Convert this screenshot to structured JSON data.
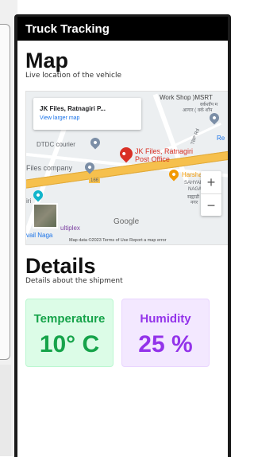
{
  "app": {
    "title": "Truck Tracking"
  },
  "map_section": {
    "title": "Map",
    "subtitle": "Live location of the vehicle",
    "map": {
      "info_title": "JK Files, Ratnagiri P...",
      "info_link": "View larger map",
      "place_workshop": "Work Shop )MSRT",
      "place_workshop_local": "वर्कशॉप म",
      "place_workshop_local2": "आगार ( वर्क शॉप",
      "place_dtdc": "DTDC courier",
      "place_pin_line1": "JK Files, Ratnagiri",
      "place_pin_line2": "Post Office",
      "place_files_company": "Files company",
      "place_haruba": "Harsha Te",
      "place_sahyadri": "SAHYADRI",
      "place_nagar": "NAGAR",
      "place_sahyadri_local": "सह्याद्री",
      "place_nagar_local": "नगर",
      "place_iri": "iri",
      "place_ultiplex": "ultiplex",
      "place_vail_naga": "vail Naga",
      "road_166": "166",
      "road_tbp": "TBP Rd",
      "place_re": "Re",
      "zoom_in": "+",
      "zoom_out": "−",
      "google_logo": "Google",
      "attribution": "Map data ©2023   Terms of Use   Report a map error"
    }
  },
  "details_section": {
    "title": "Details",
    "subtitle": "Details about the shipment",
    "cards": [
      {
        "label": "Temperature",
        "value": "10° C"
      },
      {
        "label": "Humidity",
        "value": "25 %"
      }
    ]
  },
  "colors": {
    "temperature": "#16a34a",
    "humidity": "#9333ea",
    "titlebar": "#000000",
    "highway": "#f6c04d"
  }
}
